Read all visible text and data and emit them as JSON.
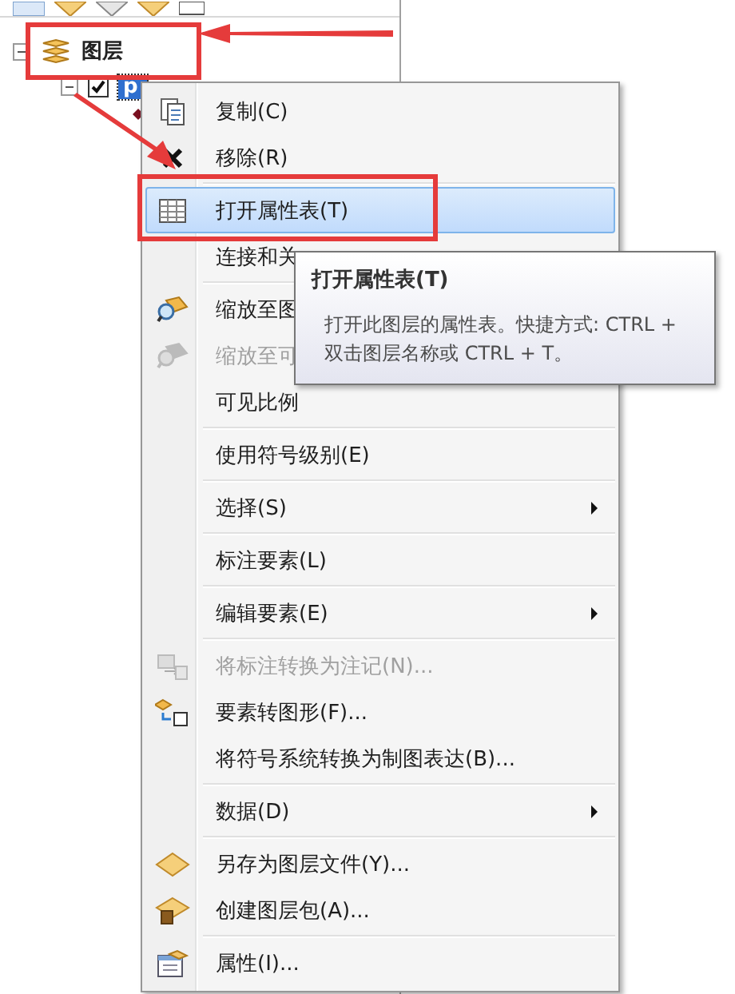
{
  "tree": {
    "root": {
      "label": "图层",
      "expanded": true
    },
    "layer": {
      "label": "p",
      "checked": true,
      "expanded": true,
      "selected": true
    }
  },
  "menu": {
    "sections": [
      [
        {
          "label": "复制(C)",
          "kind": "copy",
          "disabled": false,
          "selected": false,
          "submenu": false
        },
        {
          "label": "移除(R)",
          "kind": "remove",
          "disabled": false,
          "selected": false,
          "submenu": false
        }
      ],
      [
        {
          "label": "打开属性表(T)",
          "kind": "table",
          "disabled": false,
          "selected": true,
          "submenu": false
        },
        {
          "label": "连接和关",
          "kind": "plain",
          "disabled": false,
          "selected": false,
          "submenu": false
        }
      ],
      [
        {
          "label": "缩放至图",
          "kind": "zoom",
          "disabled": false,
          "selected": false,
          "submenu": false
        },
        {
          "label": "缩放至可",
          "kind": "zoom",
          "disabled": true,
          "selected": false,
          "submenu": false
        },
        {
          "label": "可见比例",
          "kind": "plain",
          "disabled": false,
          "selected": false,
          "submenu": false
        }
      ],
      [
        {
          "label": "使用符号级别(E)",
          "kind": "plain",
          "disabled": false,
          "selected": false,
          "submenu": false
        }
      ],
      [
        {
          "label": "选择(S)",
          "kind": "plain",
          "disabled": false,
          "selected": false,
          "submenu": true
        }
      ],
      [
        {
          "label": "标注要素(L)",
          "kind": "plain",
          "disabled": false,
          "selected": false,
          "submenu": false
        }
      ],
      [
        {
          "label": "编辑要素(E)",
          "kind": "plain",
          "disabled": false,
          "selected": false,
          "submenu": true
        }
      ],
      [
        {
          "label": "将标注转换为注记(N)...",
          "kind": "convert",
          "disabled": true,
          "selected": false,
          "submenu": false
        },
        {
          "label": "要素转图形(F)...",
          "kind": "graphics",
          "disabled": false,
          "selected": false,
          "submenu": false
        },
        {
          "label": "将符号系统转换为制图表达(B)...",
          "kind": "plain",
          "disabled": false,
          "selected": false,
          "submenu": false
        }
      ],
      [
        {
          "label": "数据(D)",
          "kind": "plain",
          "disabled": false,
          "selected": false,
          "submenu": true
        }
      ],
      [
        {
          "label": "另存为图层文件(Y)...",
          "kind": "layerfile",
          "disabled": false,
          "selected": false,
          "submenu": false
        },
        {
          "label": "创建图层包(A)...",
          "kind": "package",
          "disabled": false,
          "selected": false,
          "submenu": false
        }
      ],
      [
        {
          "label": "属性(I)...",
          "kind": "properties",
          "disabled": false,
          "selected": false,
          "submenu": false
        }
      ]
    ]
  },
  "tooltip": {
    "title": "打开属性表(T)",
    "text": "打开此图层的属性表。快捷方式: CTRL + 双击图层名称或 CTRL + T。"
  }
}
